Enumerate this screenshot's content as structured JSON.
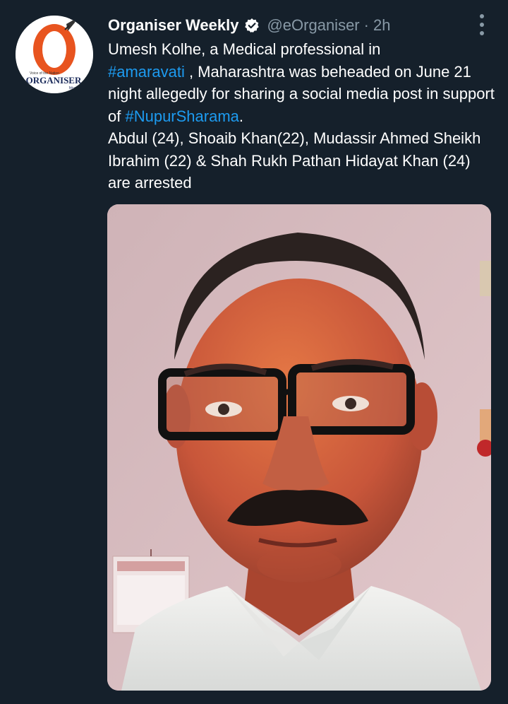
{
  "tweet": {
    "display_name": "Organiser Weekly",
    "handle": "@eOrganiser",
    "separator": "·",
    "time": "2h",
    "text": {
      "line1_before": "Umesh Kolhe, a Medical  professional in",
      "hashtag1": "#amaravati",
      "line2_after": " , Maharashtra was beheaded on June 21 night allegedly for sharing a social media post in support of ",
      "hashtag2": "#NupurSharama",
      "line3_after": ".",
      "paragraph2": "Abdul (24), Shoaib Khan(22), Mudassir Ahmed Sheikh Ibrahim (22) & Shah Rukh Pathan Hidayat Khan (24) are arrested"
    }
  },
  "avatar": {
    "logo_text": "ORGANISER",
    "logo_subtext": "Weekly"
  },
  "icons": {
    "verified": "verified-badge-icon",
    "more": "more-options-icon"
  },
  "colors": {
    "background": "#15202b",
    "link": "#1d9bf0",
    "secondary_text": "#8899a6",
    "logo_orange": "#e8541f"
  }
}
